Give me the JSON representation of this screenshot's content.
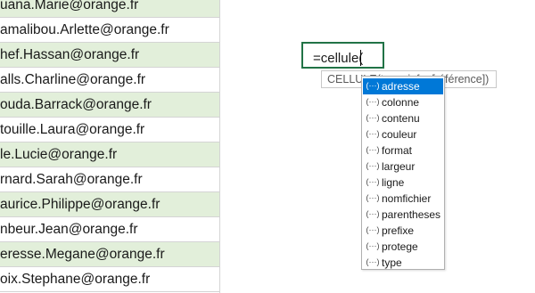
{
  "column_a": {
    "cells": [
      "uana.Marie@orange.fr",
      "amalibou.Arlette@orange.fr",
      "hef.Hassan@orange.fr",
      "alls.Charline@orange.fr",
      "ouda.Barrack@orange.fr",
      "touille.Laura@orange.fr",
      "le.Lucie@orange.fr",
      "rnard.Sarah@orange.fr",
      "aurice.Philippe@orange.fr",
      "nbeur.Jean@orange.fr",
      "eresse.Megane@orange.fr",
      "oix.Stephane@orange.fr"
    ]
  },
  "formula": {
    "text": "=cellule("
  },
  "tooltip": {
    "text": "CELLULE(type_info; [référence])"
  },
  "autocomplete": {
    "icon_glyph": "(···)",
    "items": [
      "adresse",
      "colonne",
      "contenu",
      "couleur",
      "format",
      "largeur",
      "ligne",
      "nomfichier",
      "parentheses",
      "prefixe",
      "protege",
      "type"
    ],
    "selected_index": 0
  },
  "colors": {
    "band_green": "#e2efda",
    "active_cell_border": "#217346",
    "selection_blue": "#0078d7"
  }
}
